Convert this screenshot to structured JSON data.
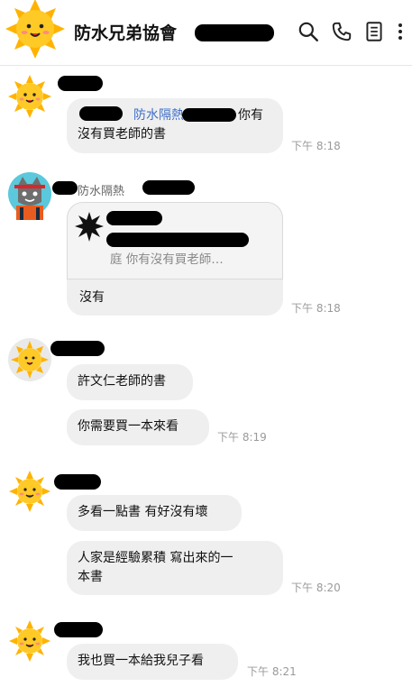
{
  "header": {
    "title": "防水兄弟協會",
    "icons": [
      "search-icon",
      "phone-icon",
      "notes-icon",
      "more-icon"
    ]
  },
  "messages": [
    {
      "text_prefix": "防水隔熱",
      "text_suffix": "你有",
      "line2": "沒有買老師的書",
      "time": "下午 8:18"
    },
    {
      "sender": "防水隔熱",
      "quote_text": "庭 你有沒有買老師…",
      "text": "沒有",
      "time": "下午 8:18"
    },
    {
      "text": "許文仁老師的書"
    },
    {
      "text": "你需要買一本來看",
      "time": "下午 8:19"
    },
    {
      "text": "多看一點書 有好沒有壞"
    },
    {
      "line1": "人家是經驗累積 寫出來的一",
      "line2": "本書",
      "time": "下午 8:20"
    },
    {
      "text": "我也買一本給我兒子看",
      "time": "下午 8:21"
    }
  ],
  "colors": {
    "bubble": "#efefef",
    "link": "#3f6fc8",
    "time": "#9a9a9a"
  }
}
